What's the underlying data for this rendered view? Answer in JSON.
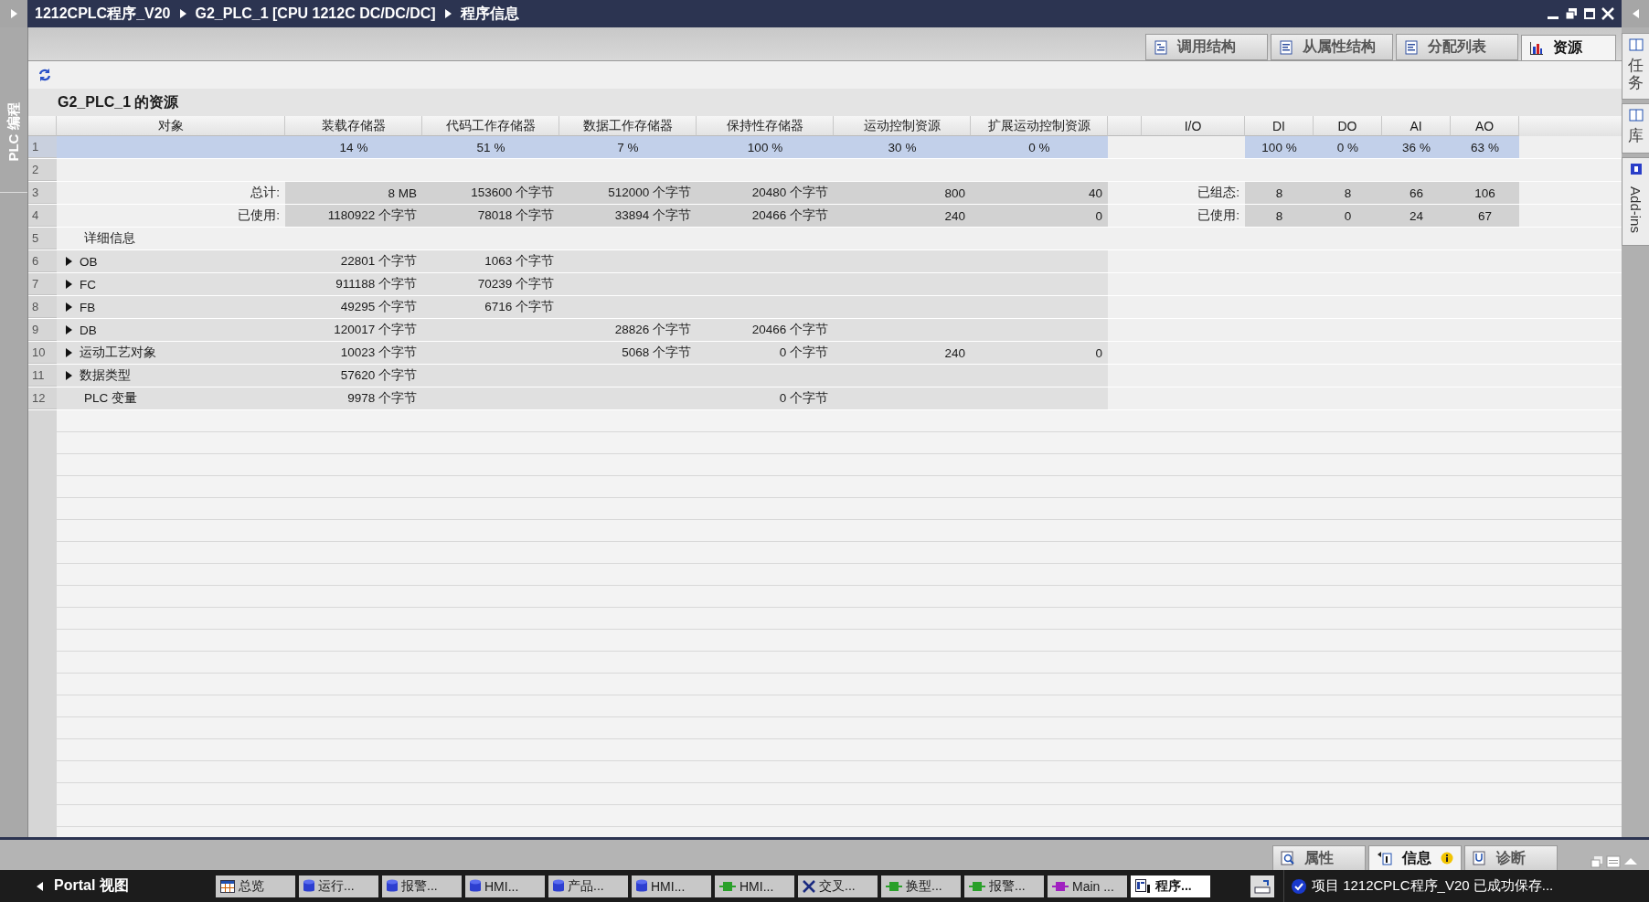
{
  "breadcrumb": [
    "1212CPLC程序_V20",
    "G2_PLC_1 [CPU 1212C DC/DC/DC]",
    "程序信息"
  ],
  "left_panel": {
    "label": "PLC 编程"
  },
  "view_tabs": [
    {
      "label": "调用结构",
      "selected": false
    },
    {
      "label": "从属性结构",
      "selected": false
    },
    {
      "label": "分配列表",
      "selected": false
    },
    {
      "label": "资源",
      "selected": true
    }
  ],
  "section_title": "G2_PLC_1 的资源",
  "table": {
    "columns": [
      "对象",
      "装载存储器",
      "代码工作存储器",
      "数据工作存储器",
      "保持性存储器",
      "运动控制资源",
      "扩展运动控制资源"
    ],
    "io_columns": [
      "I/O",
      "DI",
      "DO",
      "AI",
      "AO"
    ],
    "rows": [
      {
        "number": "1",
        "kind": "percent",
        "selected": true,
        "cells": [
          null,
          "14 %",
          "51 %",
          "7 %",
          "100 %",
          "30 %",
          "0 %"
        ],
        "io_cells": [
          null,
          "100 %",
          "0 %",
          "36 %",
          "63 %"
        ]
      },
      {
        "number": "2",
        "kind": "blank",
        "selected": false
      },
      {
        "number": "3",
        "kind": "summary",
        "selected": false,
        "cells": [
          "总计:",
          "8 MB",
          "153600 个字节",
          "512000 个字节",
          "20480 个字节",
          "800",
          "40"
        ],
        "io_cells": [
          "已组态:",
          "8",
          "8",
          "66",
          "106"
        ]
      },
      {
        "number": "4",
        "kind": "summary",
        "selected": false,
        "cells": [
          "已使用:",
          "1180922 个字节",
          "78018 个字节",
          "33894 个字节",
          "20466 个字节",
          "240",
          "0"
        ],
        "io_cells": [
          "已使用:",
          "8",
          "0",
          "24",
          "67"
        ]
      },
      {
        "number": "5",
        "kind": "section",
        "selected": false,
        "cells": [
          "详细信息",
          null,
          null,
          null,
          null,
          null,
          null
        ]
      },
      {
        "number": "6",
        "kind": "detail",
        "selected": false,
        "expanded": false,
        "cells": [
          "OB",
          "22801 个字节",
          "1063 个字节",
          null,
          null,
          null,
          null
        ]
      },
      {
        "number": "7",
        "kind": "detail",
        "selected": false,
        "expanded": false,
        "cells": [
          "FC",
          "911188 个字节",
          "70239 个字节",
          null,
          null,
          null,
          null
        ]
      },
      {
        "number": "8",
        "kind": "detail",
        "selected": false,
        "expanded": false,
        "cells": [
          "FB",
          "49295 个字节",
          "6716 个字节",
          null,
          null,
          null,
          null
        ]
      },
      {
        "number": "9",
        "kind": "detail",
        "selected": false,
        "expanded": false,
        "cells": [
          "DB",
          "120017 个字节",
          null,
          "28826 个字节",
          "20466 个字节",
          null,
          null
        ]
      },
      {
        "number": "10",
        "kind": "detail",
        "selected": false,
        "expanded": false,
        "cells": [
          "运动工艺对象",
          "10023 个字节",
          null,
          "5068 个字节",
          "0 个字节",
          "240",
          "0"
        ]
      },
      {
        "number": "11",
        "kind": "detail",
        "selected": false,
        "expanded": false,
        "cells": [
          "数据类型",
          "57620 个字节",
          null,
          null,
          null,
          null,
          null
        ]
      },
      {
        "number": "12",
        "kind": "leaf",
        "selected": false,
        "cells": [
          "PLC 变量",
          "9978 个字节",
          null,
          null,
          "0 个字节",
          null,
          null
        ]
      }
    ]
  },
  "right_panel": [
    {
      "label": "任务",
      "kind": "vertical_cjk"
    },
    {
      "label": "库",
      "kind": "vertical_cjk"
    },
    {
      "label": "Add-ins",
      "kind": "rotated"
    }
  ],
  "inspector_tabs": [
    {
      "label": "属性",
      "selected": false,
      "info": false
    },
    {
      "label": "信息",
      "selected": true,
      "info": true
    },
    {
      "label": "诊断",
      "selected": false,
      "info": false
    }
  ],
  "taskbar": {
    "portal": "Portal 视图",
    "items": [
      {
        "label": "总览",
        "kind": "table",
        "selected": false
      },
      {
        "label": "运行...",
        "kind": "database",
        "selected": false
      },
      {
        "label": "报警...",
        "kind": "database",
        "selected": false
      },
      {
        "label": "HMI...",
        "kind": "database",
        "selected": false
      },
      {
        "label": "产品...",
        "kind": "database",
        "selected": false
      },
      {
        "label": "HMI...",
        "kind": "database",
        "selected": false
      },
      {
        "label": "HMI...",
        "kind": "block",
        "color": "#2aa02a",
        "selected": false
      },
      {
        "label": "交叉...",
        "kind": "cross",
        "selected": false
      },
      {
        "label": "换型...",
        "kind": "block",
        "color": "#2aa02a",
        "selected": false
      },
      {
        "label": "报警...",
        "kind": "block",
        "color": "#2aa02a",
        "selected": false
      },
      {
        "label": "Main ...",
        "kind": "block",
        "color": "#a020c0",
        "selected": false
      },
      {
        "label": "程序...",
        "kind": "program",
        "selected": true
      }
    ],
    "status": "项目 1212CPLC程序_V20 已成功保存..."
  }
}
